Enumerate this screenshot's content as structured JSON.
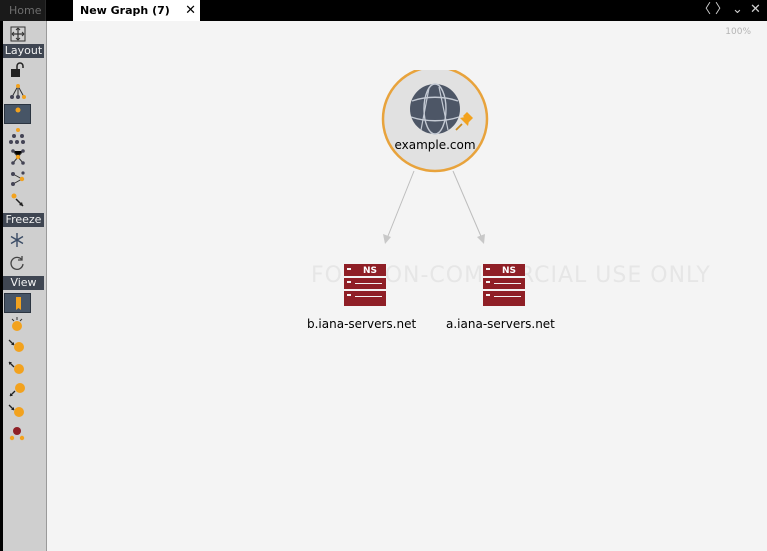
{
  "tabs": {
    "home_label": "Home",
    "active_label": "New Graph (7)",
    "close_glyph": "✕"
  },
  "window_controls": {
    "prev_glyph": "〈",
    "next_glyph": "〉",
    "menu_glyph": "⌄",
    "close_glyph": "✕"
  },
  "sidebar": {
    "sections": [
      {
        "label": "Layout"
      },
      {
        "label": "Freeze"
      },
      {
        "label": "View"
      }
    ],
    "tools": [
      {
        "icon": "move-icon"
      },
      {
        "icon": "unlock-icon"
      },
      {
        "icon": "tree-layout-icon"
      },
      {
        "icon": "single-node-icon"
      },
      {
        "icon": "hierarchy-layout-icon"
      },
      {
        "icon": "organic-layout-icon"
      },
      {
        "icon": "circular-layout-icon"
      },
      {
        "icon": "pointer-node-icon"
      },
      {
        "icon": "snowflake-icon"
      },
      {
        "icon": "refresh-icon"
      },
      {
        "icon": "bookmark-icon"
      },
      {
        "icon": "node-sparkle-icon"
      },
      {
        "icon": "node-incoming-icon"
      },
      {
        "icon": "node-outgoing-icon"
      },
      {
        "icon": "node-link-icon"
      },
      {
        "icon": "node-arrow-icon"
      },
      {
        "icon": "node-cluster-icon"
      }
    ]
  },
  "canvas": {
    "zoom": "100%",
    "watermark": "FOR NON-COMMERCIAL USE ONLY",
    "nodes": [
      {
        "label": "example.com",
        "type": "domain",
        "icon": "globe-icon",
        "pinned": true
      },
      {
        "label": "b.iana-servers.net",
        "type": "NS",
        "icon": "ns-server-icon"
      },
      {
        "label": "a.iana-servers.net",
        "type": "NS",
        "icon": "ns-server-icon"
      }
    ],
    "ns_badge": "NS",
    "colors": {
      "hub_ring": "#e8a33c",
      "server": "#8f1f26",
      "edge": "#bdbdbd",
      "tool_node": "#f2a21e"
    }
  }
}
